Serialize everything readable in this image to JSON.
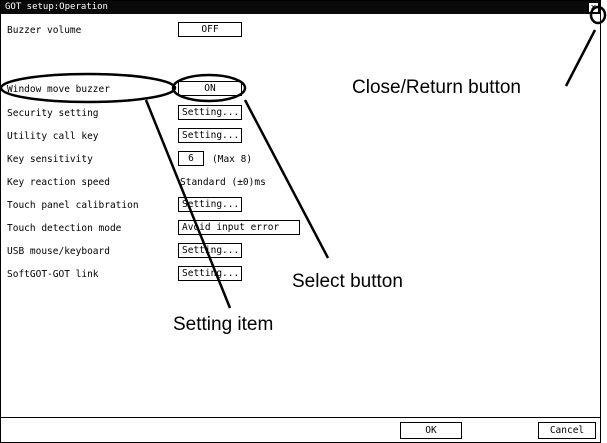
{
  "window": {
    "title": "GOT setup:Operation",
    "close_glyph": "×"
  },
  "settings": {
    "buzzer_volume": {
      "label": "Buzzer volume",
      "value": "OFF"
    },
    "window_move_buzzer": {
      "label": "Window move buzzer",
      "value": "ON"
    },
    "security_setting": {
      "label": "Security setting",
      "value": "Setting..."
    },
    "utility_call_key": {
      "label": "Utility call key",
      "value": "Setting..."
    },
    "key_sensitivity": {
      "label": "Key sensitivity",
      "value": "6",
      "note": "(Max 8)"
    },
    "key_reaction_speed": {
      "label": "Key reaction speed",
      "value": "Standard (±0)ms"
    },
    "touch_panel_calibration": {
      "label": "Touch panel calibration",
      "value": "Setting..."
    },
    "touch_detection_mode": {
      "label": "Touch detection mode",
      "value": "Avoid input error"
    },
    "usb_mouse_keyboard": {
      "label": "USB mouse/keyboard",
      "value": "Setting..."
    },
    "softgot_got_link": {
      "label": "SoftGOT-GOT link",
      "value": "Setting..."
    }
  },
  "footer": {
    "ok_label": "OK",
    "cancel_label": "Cancel"
  },
  "annotations": {
    "close_return": "Close/Return button",
    "select_button": "Select button",
    "setting_item": "Setting item"
  }
}
